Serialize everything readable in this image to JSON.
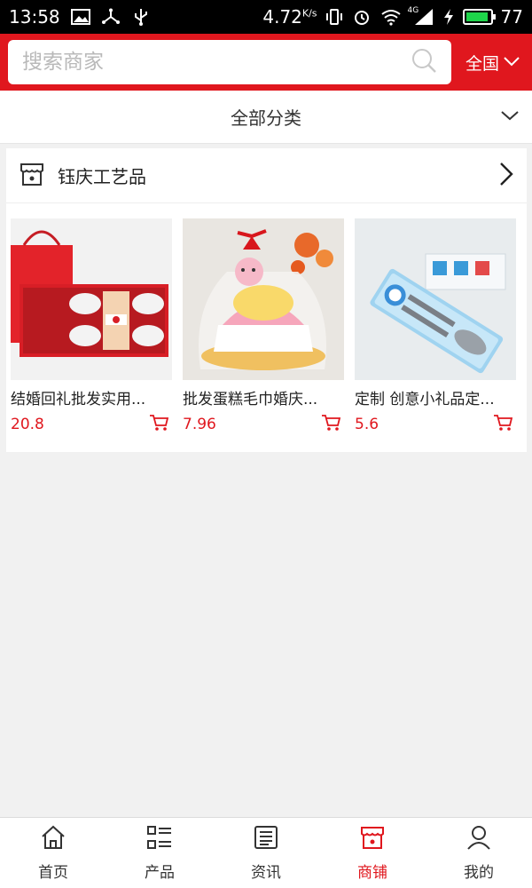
{
  "status_bar": {
    "time": "13:58",
    "net_speed": "4.72",
    "net_unit": "K/s",
    "signal_label": "4G",
    "battery": "77"
  },
  "search": {
    "placeholder": "搜索商家",
    "region_label": "全国"
  },
  "category": {
    "title": "全部分类"
  },
  "shop": {
    "name": "钰庆工艺品",
    "products": [
      {
        "name": "结婚回礼批发实用...",
        "price": "20.8"
      },
      {
        "name": "批发蛋糕毛巾婚庆...",
        "price": "7.96"
      },
      {
        "name": "定制 创意小礼品定...",
        "price": "5.6"
      }
    ]
  },
  "bottom_nav": {
    "items": [
      {
        "label": "首页",
        "icon": "home-icon"
      },
      {
        "label": "产品",
        "icon": "list-icon"
      },
      {
        "label": "资讯",
        "icon": "news-icon"
      },
      {
        "label": "商铺",
        "icon": "shop-icon",
        "active": true
      },
      {
        "label": "我的",
        "icon": "user-icon"
      }
    ]
  },
  "colors": {
    "brand_red": "#e0171e",
    "price_red": "#e0171e",
    "background": "#f1f1f1"
  }
}
